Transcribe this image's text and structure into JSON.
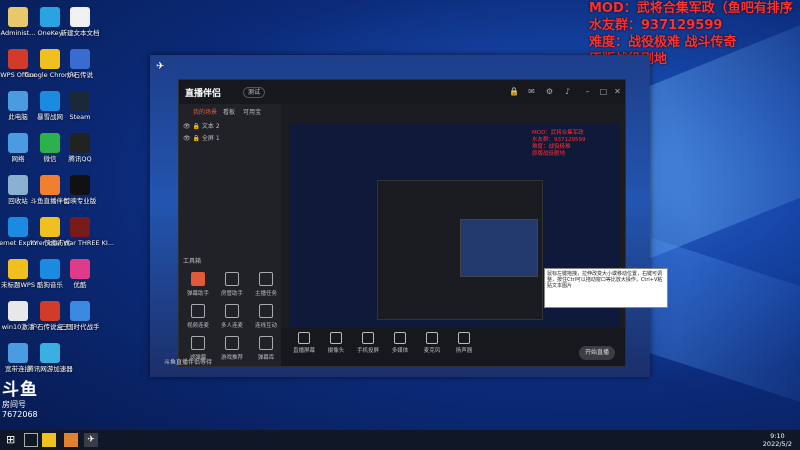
{
  "overlay": {
    "lines": [
      "MOD：武将合集军政（鱼吧有排序",
      "水友群：937129599",
      "难度：战役极难 战斗传奇",
      "原版战役剧地"
    ]
  },
  "desktop": {
    "icons": [
      {
        "label": "Administ...",
        "color": "#e8c86a"
      },
      {
        "label": "OneKey",
        "color": "#2aa3e0"
      },
      {
        "label": "新建文本文档",
        "color": "#f0f0f0"
      },
      {
        "label": "WPS Office",
        "color": "#d23a2a"
      },
      {
        "label": "Google Chrome",
        "color": "#f0c020"
      },
      {
        "label": "炉石传说",
        "color": "#3a6bd0"
      },
      {
        "label": "此电脑",
        "color": "#4a9be0"
      },
      {
        "label": "暴雪战网",
        "color": "#1a8be0"
      },
      {
        "label": "Steam",
        "color": "#1b2838"
      },
      {
        "label": "网络",
        "color": "#4a9be0"
      },
      {
        "label": "微信",
        "color": "#2bb24c"
      },
      {
        "label": "腾讯QQ",
        "color": "#222"
      },
      {
        "label": "回收站",
        "color": "#8ab0d0"
      },
      {
        "label": "斗鱼直播伴侣",
        "color": "#f08030"
      },
      {
        "label": "剪映专业版",
        "color": "#111"
      },
      {
        "label": "Internet Explorer",
        "color": "#1a8be0"
      },
      {
        "label": "YY - 快捷方式",
        "color": "#f0c020"
      },
      {
        "label": "Total War THREE KI...",
        "color": "#7a1a1a"
      },
      {
        "label": "未标题WPS",
        "color": "#f0c020"
      },
      {
        "label": "酷狗音乐",
        "color": "#1a8be0"
      },
      {
        "label": "优酷",
        "color": "#e03a8a"
      },
      {
        "label": "win10激活",
        "color": "#e8e8e8"
      },
      {
        "label": "炉石传说盒子",
        "color": "#d23a2a"
      },
      {
        "label": "三国时代战手",
        "color": "#3a8be0"
      },
      {
        "label": "宽带连接",
        "color": "#4a9be0"
      },
      {
        "label": "腾讯网游加速器",
        "color": "#3ab0e0"
      }
    ]
  },
  "app": {
    "logo": "直播伴侣",
    "version": "测试",
    "tabs": [
      "我的场景",
      "看板",
      "可用宝"
    ],
    "scenes": [
      "文本 2",
      "全屏 1"
    ],
    "tools_title": "工具箱",
    "tools": [
      "弹幕助手",
      "房管助手",
      "主播任务",
      "视频连麦",
      "多人连麦",
      "连线互动",
      "滤弹幕",
      "游戏推荐",
      "弹幕库"
    ],
    "bottom_buttons": [
      "直播屏幕",
      "摄像头",
      "手机投屏",
      "多媒体",
      "麦克风",
      "扬声器"
    ],
    "start_live": "开始直播",
    "status": "斗鱼直播伴侣等待"
  },
  "tooltip": {
    "text": "鼠标左键拖拽，拉伸改变大小或移动位置，右键可调整，按住Ctrl可以拖动窗口等比放大操作，Ctrl+V粘贴文本图片"
  },
  "watermark": {
    "brand": "斗鱼",
    "room_label": "房间号",
    "room_id": "7672068"
  },
  "taskbar": {
    "time": "9:10",
    "date": "2022/5/2"
  }
}
